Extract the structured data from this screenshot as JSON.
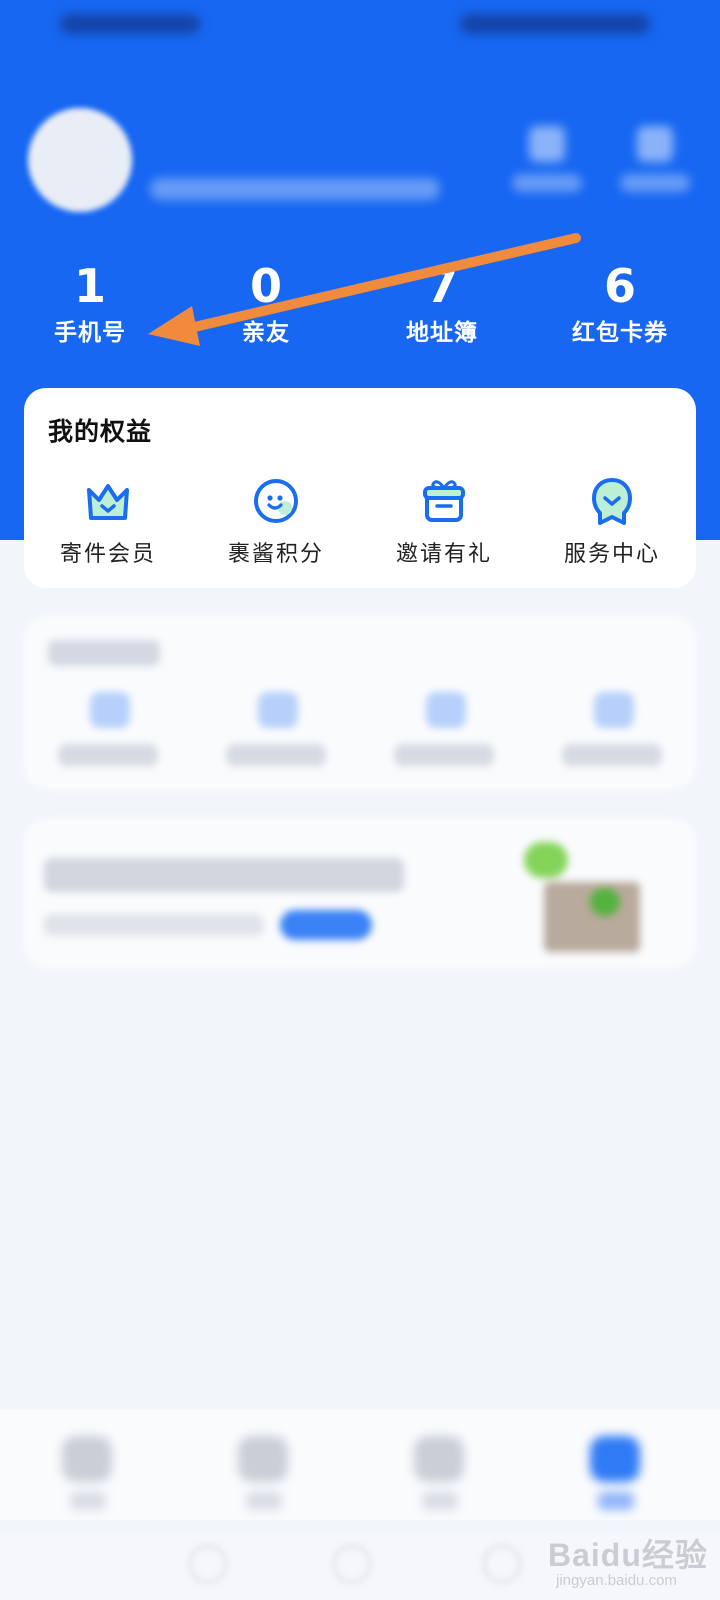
{
  "colors": {
    "primary_blue": "#1767f2",
    "arrow_orange": "#f08a3c",
    "icon_blue": "#1a6cf0",
    "icon_mint": "#bdeed6"
  },
  "stats": [
    {
      "value": "1",
      "label": "手机号"
    },
    {
      "value": "0",
      "label": "亲友"
    },
    {
      "value": "7",
      "label": "地址簿"
    },
    {
      "value": "6",
      "label": "红包卡券"
    }
  ],
  "benefits": {
    "title": "我的权益",
    "items": [
      {
        "label": "寄件会员",
        "icon": "crown-icon"
      },
      {
        "label": "裹酱积分",
        "icon": "smiley-face-icon"
      },
      {
        "label": "邀请有礼",
        "icon": "gift-box-icon"
      },
      {
        "label": "服务中心",
        "icon": "service-badge-icon"
      }
    ]
  },
  "watermark": {
    "main": "Baidu经验",
    "sub": "jingyan.baidu.com"
  }
}
